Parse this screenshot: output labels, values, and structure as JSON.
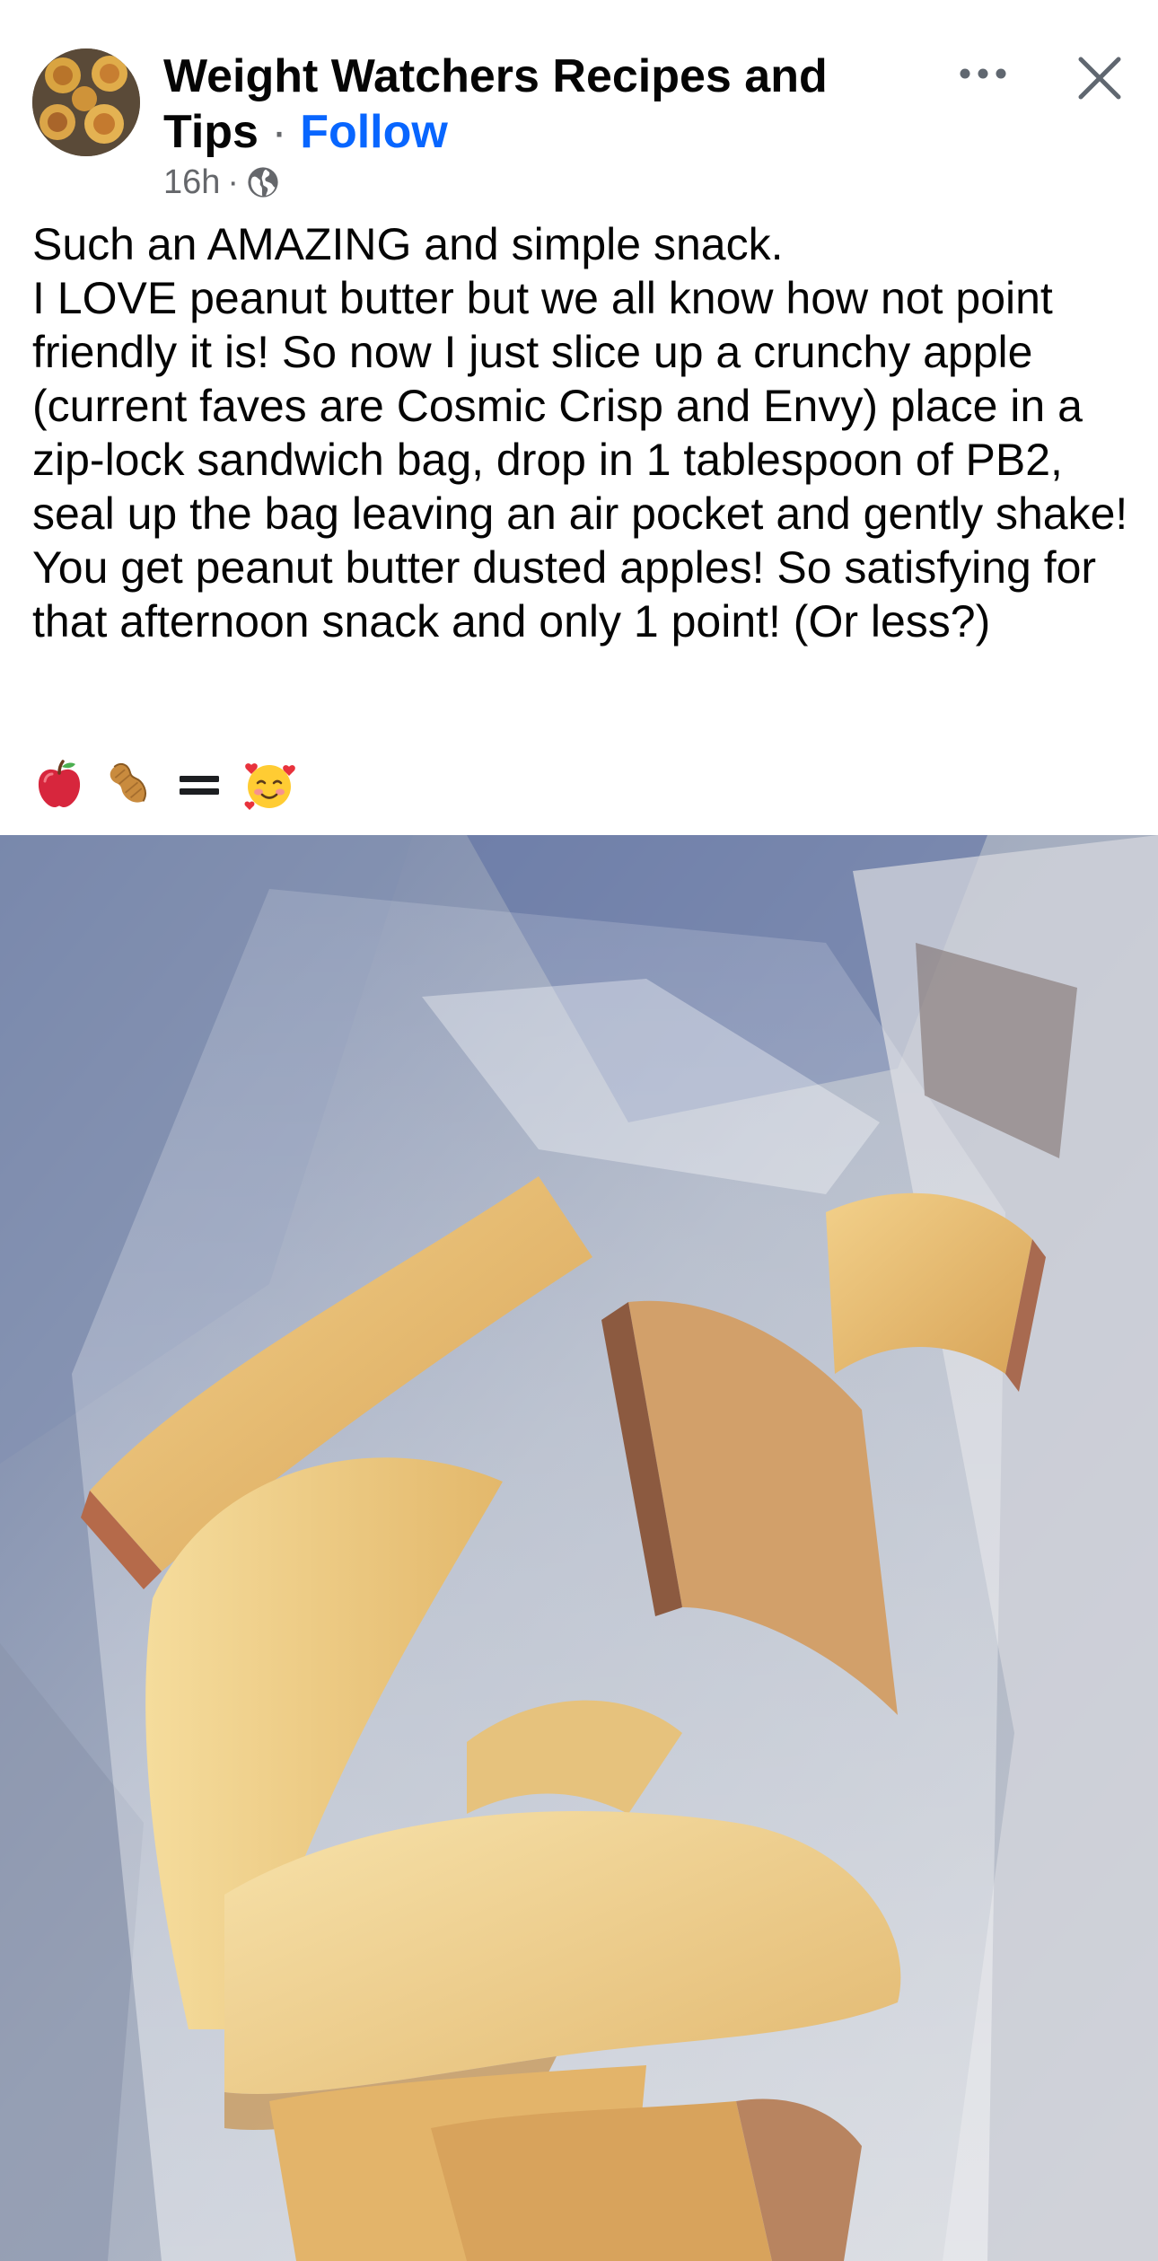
{
  "post": {
    "page_name": "Weight Watchers Recipes and Tips",
    "dot_separator": "·",
    "follow_label": "Follow",
    "time": "16h",
    "meta_separator": "·",
    "audience_icon": "globe-icon",
    "more_icon": "more-horizontal-icon",
    "close_icon": "close-icon",
    "text_lines": [
      "Such an AMAZING and simple snack.",
      "I LOVE peanut butter but we all know how not point friendly it is! So now I just slice up a crunchy apple (current faves are Cosmic Crisp and Envy) place in a zip-lock sandwich bag, drop in 1 tablespoon of PB2, seal up the bag leaving an air pocket and gently shake!",
      "You get peanut butter dusted apples! So satisfying for that afternoon snack and only 1 point! (Or less?)"
    ],
    "emojis": [
      "red-apple-emoji",
      "peanuts-emoji",
      "equals-emoji",
      "smiling-face-with-hearts-emoji"
    ]
  },
  "colors": {
    "link": "#0866ff",
    "secondary_text": "#65676b",
    "primary_text": "#050505",
    "background": "#ffffff"
  }
}
